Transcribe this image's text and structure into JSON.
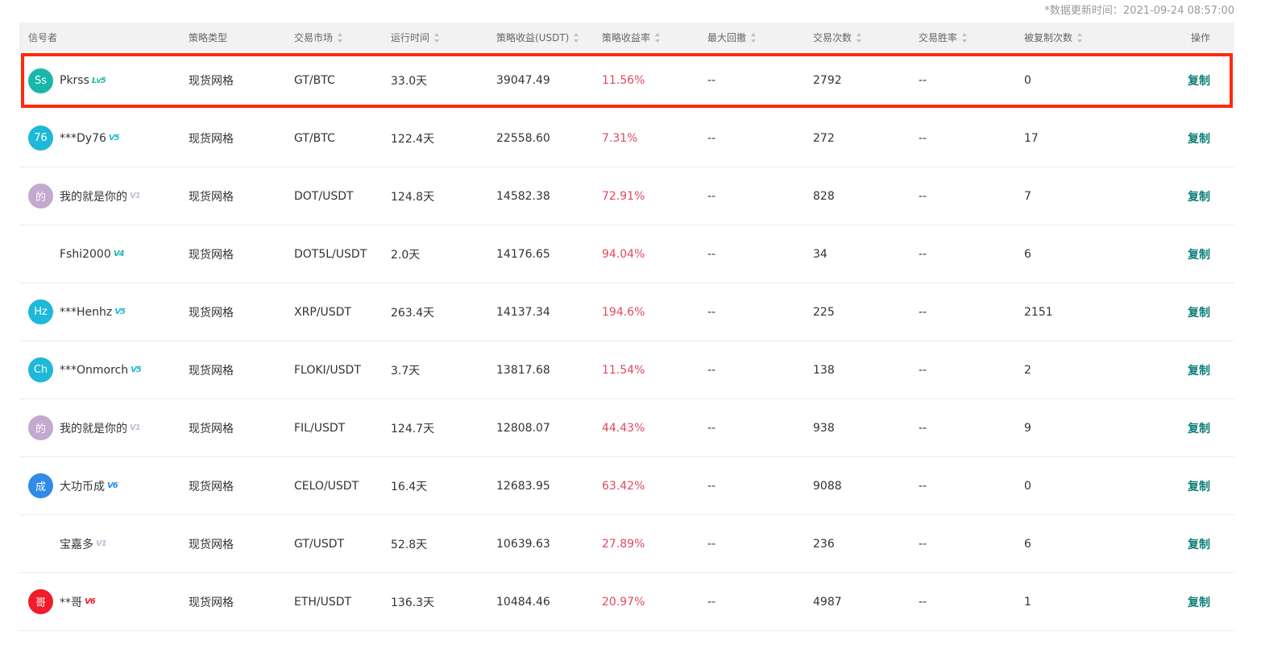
{
  "update_note": "*数据更新时间：2021-09-24 08:57:00",
  "headers": [
    "信号者",
    "策略类型",
    "交易市场",
    "运行时间",
    "策略收益(USDT)",
    "策略收益率",
    "最大回撤",
    "交易次数",
    "交易胜率",
    "被复制次数",
    "操作"
  ],
  "rows": [
    {
      "avatar": "Ss",
      "avatar_color": "#1ab6a9",
      "name": "Pkrss",
      "level": "Lv5",
      "level_color": "#1ab6a9",
      "type": "现货网格",
      "market": "GT/BTC",
      "runtime": "33.0天",
      "profit": "39047.49",
      "rate": "11.56%",
      "drawdown": "--",
      "trades": "2792",
      "winrate": "--",
      "copies": "0",
      "action": "复制"
    },
    {
      "avatar": "76",
      "avatar_color": "#1eb8d8",
      "name": "***Dy76",
      "level": "V5",
      "level_color": "#1eb8d8",
      "type": "现货网格",
      "market": "GT/BTC",
      "runtime": "122.4天",
      "profit": "22558.60",
      "rate": "7.31%",
      "drawdown": "--",
      "trades": "272",
      "winrate": "--",
      "copies": "17",
      "action": "复制"
    },
    {
      "avatar": "的",
      "avatar_color": "#c3a8d0",
      "name": "我的就是你的",
      "level": "V1",
      "level_color": "#c8b8d4",
      "type": "现货网格",
      "market": "DOT/USDT",
      "runtime": "124.8天",
      "profit": "14582.38",
      "rate": "72.91%",
      "drawdown": "--",
      "trades": "828",
      "winrate": "--",
      "copies": "7",
      "action": "复制"
    },
    {
      "avatar": "",
      "avatar_color": "",
      "name": "Fshi2000",
      "level": "V4",
      "level_color": "#1ab6a9",
      "type": "现货网格",
      "market": "DOT5L/USDT",
      "runtime": "2.0天",
      "profit": "14176.65",
      "rate": "94.04%",
      "drawdown": "--",
      "trades": "34",
      "winrate": "--",
      "copies": "6",
      "action": "复制"
    },
    {
      "avatar": "Hz",
      "avatar_color": "#1eb8d8",
      "name": "***Henhz",
      "level": "V5",
      "level_color": "#1eb8d8",
      "type": "现货网格",
      "market": "XRP/USDT",
      "runtime": "263.4天",
      "profit": "14137.34",
      "rate": "194.6%",
      "drawdown": "--",
      "trades": "225",
      "winrate": "--",
      "copies": "2151",
      "action": "复制"
    },
    {
      "avatar": "Ch",
      "avatar_color": "#1eb8d8",
      "name": "***Onmorch",
      "level": "V5",
      "level_color": "#1eb8d8",
      "type": "现货网格",
      "market": "FLOKI/USDT",
      "runtime": "3.7天",
      "profit": "13817.68",
      "rate": "11.54%",
      "drawdown": "--",
      "trades": "138",
      "winrate": "--",
      "copies": "2",
      "action": "复制"
    },
    {
      "avatar": "的",
      "avatar_color": "#c3a8d0",
      "name": "我的就是你的",
      "level": "V1",
      "level_color": "#c8b8d4",
      "type": "现货网格",
      "market": "FIL/USDT",
      "runtime": "124.7天",
      "profit": "12808.07",
      "rate": "44.43%",
      "drawdown": "--",
      "trades": "938",
      "winrate": "--",
      "copies": "9",
      "action": "复制"
    },
    {
      "avatar": "成",
      "avatar_color": "#2f8be6",
      "name": "大功币成",
      "level": "V6",
      "level_color": "#2f8be6",
      "type": "现货网格",
      "market": "CELO/USDT",
      "runtime": "16.4天",
      "profit": "12683.95",
      "rate": "63.42%",
      "drawdown": "--",
      "trades": "9088",
      "winrate": "--",
      "copies": "0",
      "action": "复制"
    },
    {
      "avatar": "",
      "avatar_color": "",
      "name": "宝嘉多",
      "level": "V1",
      "level_color": "#c8b8d4",
      "type": "现货网格",
      "market": "GT/USDT",
      "runtime": "52.8天",
      "profit": "10639.63",
      "rate": "27.89%",
      "drawdown": "--",
      "trades": "236",
      "winrate": "--",
      "copies": "6",
      "action": "复制"
    },
    {
      "avatar": "哥",
      "avatar_color": "#f21b2b",
      "name": "**哥",
      "level": "V6",
      "level_color": "#f21b2b",
      "type": "现货网格",
      "market": "ETH/USDT",
      "runtime": "136.3天",
      "profit": "10484.46",
      "rate": "20.97%",
      "drawdown": "--",
      "trades": "4987",
      "winrate": "--",
      "copies": "1",
      "action": "复制"
    }
  ]
}
